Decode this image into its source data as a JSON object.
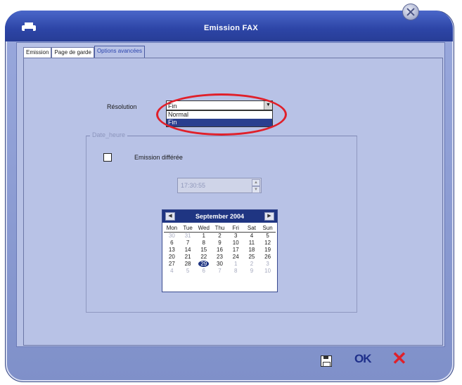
{
  "window": {
    "title": "Emission FAX"
  },
  "tabs": [
    {
      "label": "Emission"
    },
    {
      "label": "Page de garde"
    },
    {
      "label": "Options avancées"
    }
  ],
  "resolution": {
    "label": "Résolution",
    "selected": "Fin",
    "options": [
      "Normal",
      "Fin"
    ]
  },
  "datetime_group": {
    "label": "Date_heure",
    "deferred_label": "Emission différée",
    "deferred_checked": false,
    "time_value": "17:30:55"
  },
  "calendar": {
    "month": "September 2004",
    "prev_icon": "left-arrow-icon",
    "next_icon": "right-arrow-icon",
    "days_of_week": [
      "Mon",
      "Tue",
      "Wed",
      "Thu",
      "Fri",
      "Sat",
      "Sun"
    ],
    "weeks": [
      [
        "30",
        "31",
        "1",
        "2",
        "3",
        "4",
        "5"
      ],
      [
        "6",
        "7",
        "8",
        "9",
        "10",
        "11",
        "12"
      ],
      [
        "13",
        "14",
        "15",
        "16",
        "17",
        "18",
        "19"
      ],
      [
        "20",
        "21",
        "22",
        "23",
        "24",
        "25",
        "26"
      ],
      [
        "27",
        "28",
        "29",
        "30",
        "1",
        "2",
        "3"
      ],
      [
        "4",
        "5",
        "6",
        "7",
        "8",
        "9",
        "10"
      ]
    ],
    "today": "29"
  },
  "footer": {
    "ok_label": "OK",
    "cancel_label": "✕"
  },
  "colors": {
    "accent": "#2a3f8f",
    "highlight": "#e0202a",
    "panel": "#b8c2e6"
  }
}
